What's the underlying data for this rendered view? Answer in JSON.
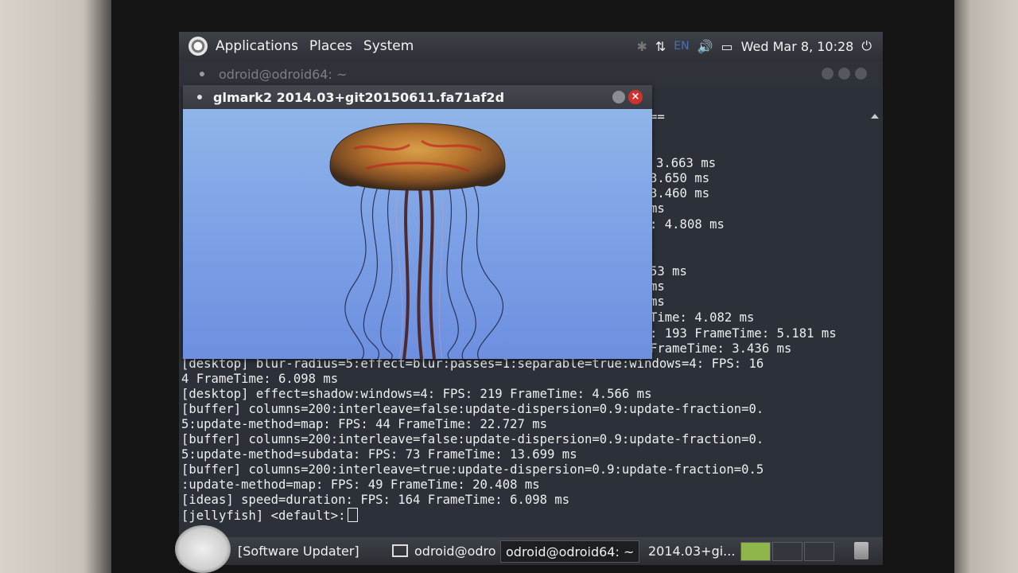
{
  "top_panel": {
    "menus": [
      "Applications",
      "Places",
      "System"
    ],
    "language": "EN",
    "clock": "Wed Mar  8, 10:28"
  },
  "terminal_window": {
    "title": "odroid@odroid64: ~"
  },
  "glmark_window": {
    "title": "glmark2 2014.03+git20150611.fa71af2d",
    "close_glyph": "×"
  },
  "terminal": {
    "partial_lines": [
      "==",
      "3.663 ms",
      "3.650 ms",
      "3.460 ms",
      "ms",
      ": 4.808 ms",
      "53 ms",
      "ms",
      "ms",
      "Time: 4.082 ms",
      ": 193 FrameTime: 5.181 ms",
      "FrameTime: 3.436 ms"
    ],
    "lines": [
      "[desktop] blur-radius=5:effect=blur:passes=1:separable=true:windows=4: FPS: 16",
      "4 FrameTime: 6.098 ms",
      "[desktop] effect=shadow:windows=4: FPS: 219 FrameTime: 4.566 ms",
      "[buffer] columns=200:interleave=false:update-dispersion=0.9:update-fraction=0.",
      "5:update-method=map: FPS: 44 FrameTime: 22.727 ms",
      "[buffer] columns=200:interleave=false:update-dispersion=0.9:update-fraction=0.",
      "5:update-method=subdata: FPS: 73 FrameTime: 13.699 ms",
      "[buffer] columns=200:interleave=true:update-dispersion=0.9:update-fraction=0.5",
      ":update-method=map: FPS: 49 FrameTime: 20.408 ms",
      "[ideas] speed=duration: FPS: 164 FrameTime: 6.098 ms",
      "[jellyfish] <default>:"
    ]
  },
  "taskbar": {
    "tasks": [
      "[Software Updater]",
      "odroid@odro",
      "odroid@odroid64: ~",
      "2014.03+gi..."
    ]
  },
  "colors": {
    "close_button": "#d2312b",
    "workspace_active": "#8eb64a",
    "gl_background": "#7ea3e6"
  }
}
